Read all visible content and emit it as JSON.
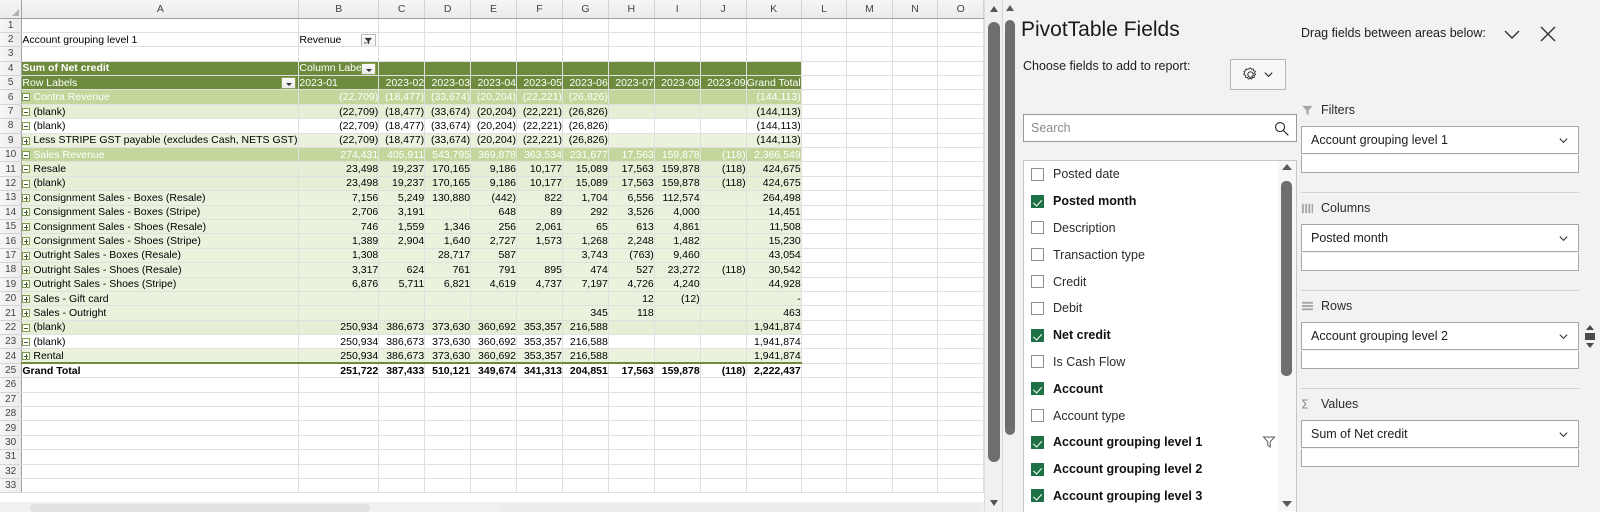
{
  "spreadsheet": {
    "column_letters": [
      "A",
      "B",
      "C",
      "D",
      "E",
      "F",
      "G",
      "H",
      "I",
      "J",
      "K",
      "L",
      "M",
      "N",
      "O"
    ],
    "row_numbers": [
      1,
      2,
      3,
      4,
      5,
      6,
      7,
      8,
      9,
      10,
      11,
      12,
      13,
      14,
      15,
      16,
      17,
      18,
      19,
      20,
      21,
      22,
      23,
      24,
      25,
      26,
      27,
      28,
      29,
      30,
      31,
      32,
      33
    ],
    "filter_field_label": "Account grouping level 1",
    "filter_value": "Revenue",
    "pivot_title": "Sum of Net credit",
    "column_labels_header": "Column Labels",
    "row_labels_header": "Row Labels",
    "column_headers": [
      "2023-01",
      "2023-02",
      "2023-03",
      "2023-04",
      "2023-05",
      "2023-06",
      "2023-07",
      "2023-08",
      "2023-09",
      "Grand Total"
    ],
    "rows": [
      {
        "row": 6,
        "label": "Contra Revenue",
        "indent": 0,
        "toggle": "minus",
        "style": "lvl1",
        "values": [
          "(22,709)",
          "(18,477)",
          "(33,674)",
          "(20,204)",
          "(22,221)",
          "(26,826)",
          "",
          "",
          "",
          "(144,113)"
        ]
      },
      {
        "row": 7,
        "label": "(blank)",
        "indent": 1,
        "toggle": "minus",
        "style": "lvl2",
        "values": [
          "(22,709)",
          "(18,477)",
          "(33,674)",
          "(20,204)",
          "(22,221)",
          "(26,826)",
          "",
          "",
          "",
          "(144,113)"
        ]
      },
      {
        "row": 8,
        "label": "(blank)",
        "indent": 2,
        "toggle": "minus",
        "style": "lvl3",
        "values": [
          "(22,709)",
          "(18,477)",
          "(33,674)",
          "(20,204)",
          "(22,221)",
          "(26,826)",
          "",
          "",
          "",
          "(144,113)"
        ]
      },
      {
        "row": 9,
        "label": "Less STRIPE GST payable (excludes Cash, NETS GST)",
        "indent": 3,
        "toggle": "plus",
        "style": "lvl4",
        "values": [
          "(22,709)",
          "(18,477)",
          "(33,674)",
          "(20,204)",
          "(22,221)",
          "(26,826)",
          "",
          "",
          "",
          "(144,113)"
        ]
      },
      {
        "row": 10,
        "label": "Sales Revenue",
        "indent": 0,
        "toggle": "minus",
        "style": "lvl1",
        "values": [
          "274,431",
          "405,911",
          "543,795",
          "369,878",
          "363,534",
          "231,677",
          "17,563",
          "159,878",
          "(118)",
          "2,366,549"
        ]
      },
      {
        "row": 11,
        "label": "Resale",
        "indent": 1,
        "toggle": "minus",
        "style": "lvl2",
        "values": [
          "23,498",
          "19,237",
          "170,165",
          "9,186",
          "10,177",
          "15,089",
          "17,563",
          "159,878",
          "(118)",
          "424,675"
        ]
      },
      {
        "row": 12,
        "label": "(blank)",
        "indent": 2,
        "toggle": "minus",
        "style": "lvl2",
        "values": [
          "23,498",
          "19,237",
          "170,165",
          "9,186",
          "10,177",
          "15,089",
          "17,563",
          "159,878",
          "(118)",
          "424,675"
        ]
      },
      {
        "row": 13,
        "label": "Consignment Sales - Boxes (Resale)",
        "indent": 3,
        "toggle": "plus",
        "style": "lvl4",
        "values": [
          "7,156",
          "5,249",
          "130,880",
          "(442)",
          "822",
          "1,704",
          "6,556",
          "112,574",
          "",
          "264,498"
        ]
      },
      {
        "row": 14,
        "label": "Consignment Sales - Boxes (Stripe)",
        "indent": 3,
        "toggle": "plus",
        "style": "lvl4",
        "values": [
          "2,706",
          "3,191",
          "",
          "648",
          "89",
          "292",
          "3,526",
          "4,000",
          "",
          "14,451"
        ]
      },
      {
        "row": 15,
        "label": "Consignment Sales - Shoes (Resale)",
        "indent": 3,
        "toggle": "plus",
        "style": "lvl4",
        "values": [
          "746",
          "1,559",
          "1,346",
          "256",
          "2,061",
          "65",
          "613",
          "4,861",
          "",
          "11,508"
        ]
      },
      {
        "row": 16,
        "label": "Consignment Sales - Shoes (Stripe)",
        "indent": 3,
        "toggle": "plus",
        "style": "lvl4",
        "values": [
          "1,389",
          "2,904",
          "1,640",
          "2,727",
          "1,573",
          "1,268",
          "2,248",
          "1,482",
          "",
          "15,230"
        ]
      },
      {
        "row": 17,
        "label": "Outright Sales - Boxes (Resale)",
        "indent": 3,
        "toggle": "plus",
        "style": "lvl4",
        "values": [
          "1,308",
          "",
          "28,717",
          "587",
          "",
          "3,743",
          "(763)",
          "9,460",
          "",
          "43,054"
        ]
      },
      {
        "row": 18,
        "label": "Outright Sales - Shoes (Resale)",
        "indent": 3,
        "toggle": "plus",
        "style": "lvl4",
        "values": [
          "3,317",
          "624",
          "761",
          "791",
          "895",
          "474",
          "527",
          "23,272",
          "(118)",
          "30,542"
        ]
      },
      {
        "row": 19,
        "label": "Outright Sales - Shoes (Stripe)",
        "indent": 3,
        "toggle": "plus",
        "style": "lvl4",
        "values": [
          "6,876",
          "5,711",
          "6,821",
          "4,619",
          "4,737",
          "7,197",
          "4,726",
          "4,240",
          "",
          "44,928"
        ]
      },
      {
        "row": 20,
        "label": "Sales - Gift card",
        "indent": 3,
        "toggle": "plus",
        "style": "lvl4",
        "values": [
          "",
          "",
          "",
          "",
          "",
          "",
          "12",
          "(12)",
          "",
          "-"
        ]
      },
      {
        "row": 21,
        "label": "Sales - Outright",
        "indent": 3,
        "toggle": "plus",
        "style": "lvl4",
        "values": [
          "",
          "",
          "",
          "",
          "",
          "345",
          "118",
          "",
          "",
          "463"
        ]
      },
      {
        "row": 22,
        "label": "(blank)",
        "indent": 1,
        "toggle": "minus",
        "style": "lvl2",
        "values": [
          "250,934",
          "386,673",
          "373,630",
          "360,692",
          "353,357",
          "216,588",
          "",
          "",
          "",
          "1,941,874"
        ]
      },
      {
        "row": 23,
        "label": "(blank)",
        "indent": 2,
        "toggle": "minus",
        "style": "lvl3",
        "values": [
          "250,934",
          "386,673",
          "373,630",
          "360,692",
          "353,357",
          "216,588",
          "",
          "",
          "",
          "1,941,874"
        ]
      },
      {
        "row": 24,
        "label": "Rental",
        "indent": 3,
        "toggle": "plus",
        "style": "lvl4",
        "values": [
          "250,934",
          "386,673",
          "373,630",
          "360,692",
          "353,357",
          "216,588",
          "",
          "",
          "",
          "1,941,874"
        ]
      },
      {
        "row": 25,
        "label": "Grand Total",
        "indent": 0,
        "toggle": "none",
        "style": "gtot",
        "values": [
          "251,722",
          "387,433",
          "510,121",
          "349,674",
          "341,313",
          "204,851",
          "17,563",
          "159,878",
          "(118)",
          "2,222,437"
        ]
      }
    ]
  },
  "panel": {
    "title": "PivotTable Fields",
    "choose_label": "Choose fields to add to report:",
    "search_placeholder": "Search",
    "drag_label": "Drag fields between areas below:",
    "fields": [
      {
        "label": "Posted date",
        "checked": false,
        "has_filter": false
      },
      {
        "label": "Posted month",
        "checked": true,
        "has_filter": false
      },
      {
        "label": "Description",
        "checked": false,
        "has_filter": false
      },
      {
        "label": "Transaction type",
        "checked": false,
        "has_filter": false
      },
      {
        "label": "Credit",
        "checked": false,
        "has_filter": false
      },
      {
        "label": "Debit",
        "checked": false,
        "has_filter": false
      },
      {
        "label": "Net credit",
        "checked": true,
        "has_filter": false
      },
      {
        "label": "Is Cash Flow",
        "checked": false,
        "has_filter": false
      },
      {
        "label": "Account",
        "checked": true,
        "has_filter": false
      },
      {
        "label": "Account type",
        "checked": false,
        "has_filter": false
      },
      {
        "label": "Account grouping level 1",
        "checked": true,
        "has_filter": true
      },
      {
        "label": "Account grouping level 2",
        "checked": true,
        "has_filter": false
      },
      {
        "label": "Account grouping level 3",
        "checked": true,
        "has_filter": false
      }
    ],
    "areas": {
      "filters": {
        "title": "Filters",
        "field": "Account grouping level 1"
      },
      "columns": {
        "title": "Columns",
        "field": "Posted month"
      },
      "rows": {
        "title": "Rows",
        "field": "Account grouping level 2"
      },
      "values": {
        "title": "Values",
        "field": "Sum of Net credit"
      }
    }
  },
  "colors": {
    "pivot_header": "#6e8b3d",
    "level1_band": "#c3d69b",
    "level_band_light": "#eaf1dd",
    "checkbox_checked": "#1e7145",
    "accent_border": "#9bbb59"
  }
}
